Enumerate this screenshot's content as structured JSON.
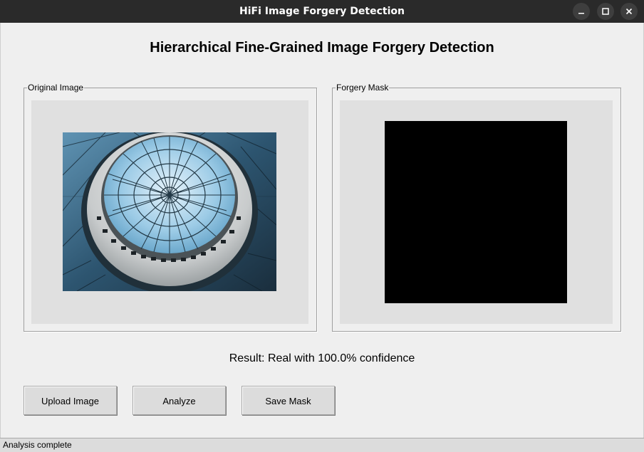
{
  "window": {
    "title": "HiFi Image Forgery Detection"
  },
  "header": {
    "title": "Hierarchical Fine-Grained Image Forgery Detection"
  },
  "panels": {
    "original": {
      "label": "Original Image"
    },
    "mask": {
      "label": "Forgery Mask"
    }
  },
  "result": {
    "text": "Result: Real with 100.0% confidence"
  },
  "buttons": {
    "upload": "Upload Image",
    "analyze": "Analyze",
    "save": "Save Mask"
  },
  "status": {
    "text": "Analysis complete"
  },
  "colors": {
    "titlebar": "#2a2a2a",
    "mask": "#000000",
    "canvas": "#e0e0e0",
    "background": "#efefef"
  }
}
